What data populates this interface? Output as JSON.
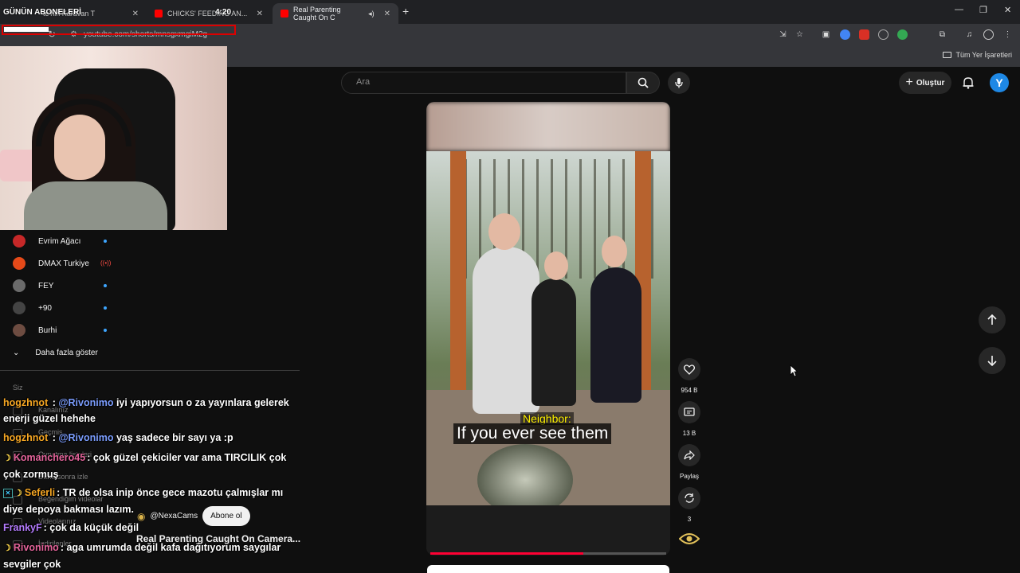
{
  "overlay": {
    "title": "GÜNÜN ABONELERİ",
    "time": "4:20"
  },
  "browser": {
    "tabs": [
      {
        "label": "te'nin Karavan T"
      },
      {
        "label": "CHICKS' FEEDING AN..."
      },
      {
        "label": "Real Parenting Caught On C"
      }
    ],
    "url": "youtube.com/shorts/mnsgxmgiM2g",
    "bookmarks_label": "Tüm Yer İşaretleri"
  },
  "sidebar": {
    "subscriptions": [
      {
        "name": "Evrim Ağacı",
        "color": "#c62828",
        "badge": "dot"
      },
      {
        "name": "DMAX Turkiye",
        "color": "#e64a19",
        "badge": "live"
      },
      {
        "name": "FEY",
        "color": "#6b6b6b",
        "badge": "dot"
      },
      {
        "name": "+90",
        "color": "#444444",
        "badge": "dot"
      },
      {
        "name": "Burhi",
        "color": "#6d4c41",
        "badge": "dot"
      }
    ],
    "show_more": "Daha fazla göster",
    "ghost_items": [
      "Siz",
      "Kanalınız",
      "Geçmiş",
      "Oynatma listeleri",
      "Daha sonra izle",
      "Beğendiğim videolar",
      "Videolarınız",
      "İndirilenler"
    ]
  },
  "chat": {
    "messages": [
      {
        "user": "hogzhnot",
        "user_color": "#f5a623",
        "mention": "@Rivonimo",
        "text": " iyi yapıyorsun o za yayınlara gelerek enerji güzel hehehe",
        "prefix": ""
      },
      {
        "user": "hogzhnot",
        "user_color": "#f5a623",
        "mention": "@Rivonimo",
        "text": " yaş sadece bir sayı ya :p",
        "prefix": ""
      },
      {
        "user": "Komanchero45",
        "user_color": "#e5649b",
        "mention": "",
        "text": ": çok güzel çekiciler var ama TIRCILIK çok çok zormuş",
        "prefix": "moon"
      },
      {
        "user": "Seferli",
        "user_color": "#f5a623",
        "mention": "",
        "text": ": TR de olsa inip önce gece mazotu çalmışlar mı diye depoya bakması lazım.",
        "prefix": "badge"
      },
      {
        "user": "FrankyF",
        "user_color": "#b57cff",
        "mention": "",
        "text": ": çok da küçük değil",
        "prefix": ""
      },
      {
        "user": "Rivonimo",
        "user_color": "#e5649b",
        "mention": "",
        "text": ": aga umrumda değil kafa dağıtıyorum saygılar sevgiler çok",
        "prefix": "moon"
      }
    ]
  },
  "masthead": {
    "search_placeholder": "Ara",
    "create_label": "Oluştur",
    "avatar_letter": "Y"
  },
  "video": {
    "caption_speaker": "Neighbor:",
    "caption_line": "If you ever see them",
    "progress": 0.65,
    "channel": "@NexaCams",
    "subscribe_label": "Abone ol",
    "title": "Real Parenting Caught On Camera..."
  },
  "actions": {
    "likes": "954 B",
    "comments": "13 B",
    "share": "Paylaş",
    "remix": "3"
  },
  "colors": {
    "accent": "#ff0033",
    "link": "#3ea6ff",
    "panel": "#272727"
  }
}
